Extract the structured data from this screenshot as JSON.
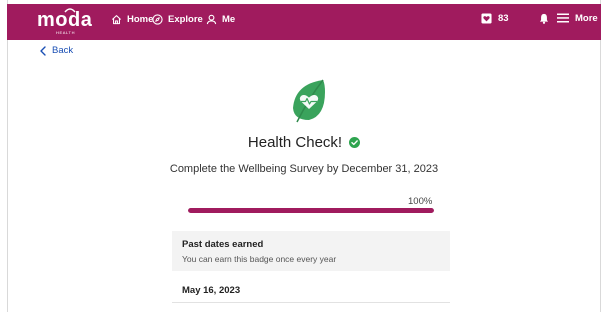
{
  "header": {
    "logo_text": "moda",
    "logo_sub": "HEALTH",
    "nav": [
      {
        "label": "Home",
        "icon": "home-icon"
      },
      {
        "label": "Explore",
        "icon": "compass-icon"
      },
      {
        "label": "Me",
        "icon": "user-icon"
      }
    ],
    "badge_count": "83",
    "more_label": "More",
    "color": "#a01b5e"
  },
  "back_label": "Back",
  "badge": {
    "title": "Health Check!",
    "subtitle": "Complete the Wellbeing Survey by December 31, 2023",
    "progress_label": "100%",
    "progress_value": 1.0,
    "icon": "heart-leaf-icon",
    "icon_color": "#3aa35c"
  },
  "past_dates": {
    "title": "Past dates earned",
    "subtitle": "You can earn this badge once every year",
    "dates": [
      "May 16, 2023"
    ]
  }
}
